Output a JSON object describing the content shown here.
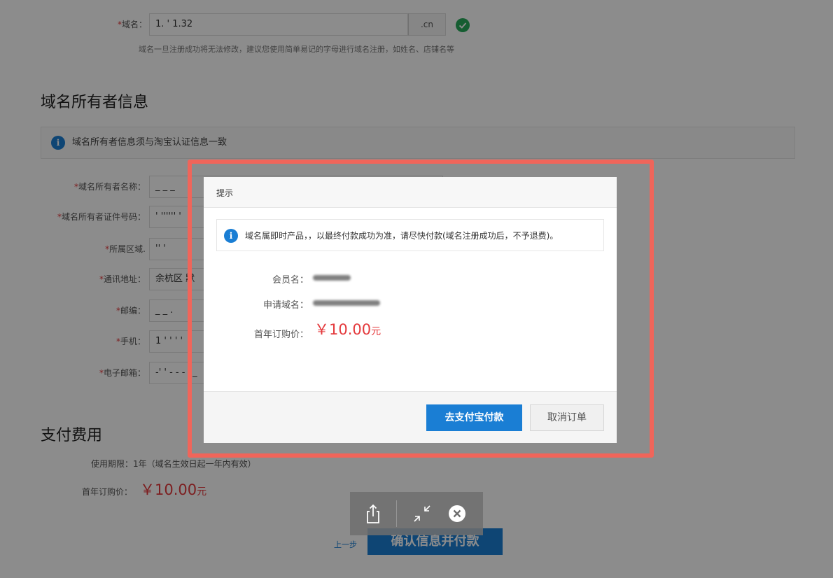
{
  "form": {
    "domain": {
      "required_mark": "*",
      "label": "域名：",
      "value": "1.   ' 1.32",
      "suffix": ".cn",
      "hint": "域名一旦注册成功将无法修改，建议您使用简单易记的字母进行域名注册，如姓名、店铺名等"
    },
    "owner_section": {
      "title": "域名所有者信息",
      "notice": "域名所有者信息须与淘宝认证信息一致"
    },
    "fields": [
      {
        "label": "域名所有者名称：",
        "value": "_ _ _"
      },
      {
        "label": "域名所有者证件号码：",
        "value": "' '''''' '"
      },
      {
        "label": "所属区域.",
        "value": "'' '"
      },
      {
        "label": "通讯地址：",
        "value": "余杭区 默"
      },
      {
        "label": "邮编：",
        "value": "_ _ ."
      },
      {
        "label": "手机：",
        "value": "1  ' ' ' '"
      },
      {
        "label": "电子邮箱：",
        "value": "-' ' - - - `_"
      }
    ],
    "required_mark": "*"
  },
  "payment": {
    "title": "支付费用",
    "period": "使用期限：1年（域名生效日起一年内有效）",
    "price_label": "首年订购价：",
    "price": "￥10.00",
    "price_unit": "元",
    "prev_link": "上一步",
    "confirm_button": "确认信息并付款"
  },
  "dialog": {
    "title": "提示",
    "notice": "域名属即时产品，，以最终付款成功为准，请尽快付款(域名注册成功后，不予退费)。",
    "member_label": "会员名：",
    "domain_label": "申请域名：",
    "price_label": "首年订购价：",
    "price": "￥10.00",
    "price_unit": "元",
    "pay_button": "去支付宝付款",
    "cancel_button": "取消订单"
  },
  "toolbar": {
    "share_icon": "share-icon",
    "shrink_icon": "shrink-icon",
    "close_icon": "close-icon"
  },
  "colors": {
    "accent": "#1a7ed4",
    "price": "#e4393c",
    "success": "#27a95a",
    "highlight": "#f0655a"
  }
}
